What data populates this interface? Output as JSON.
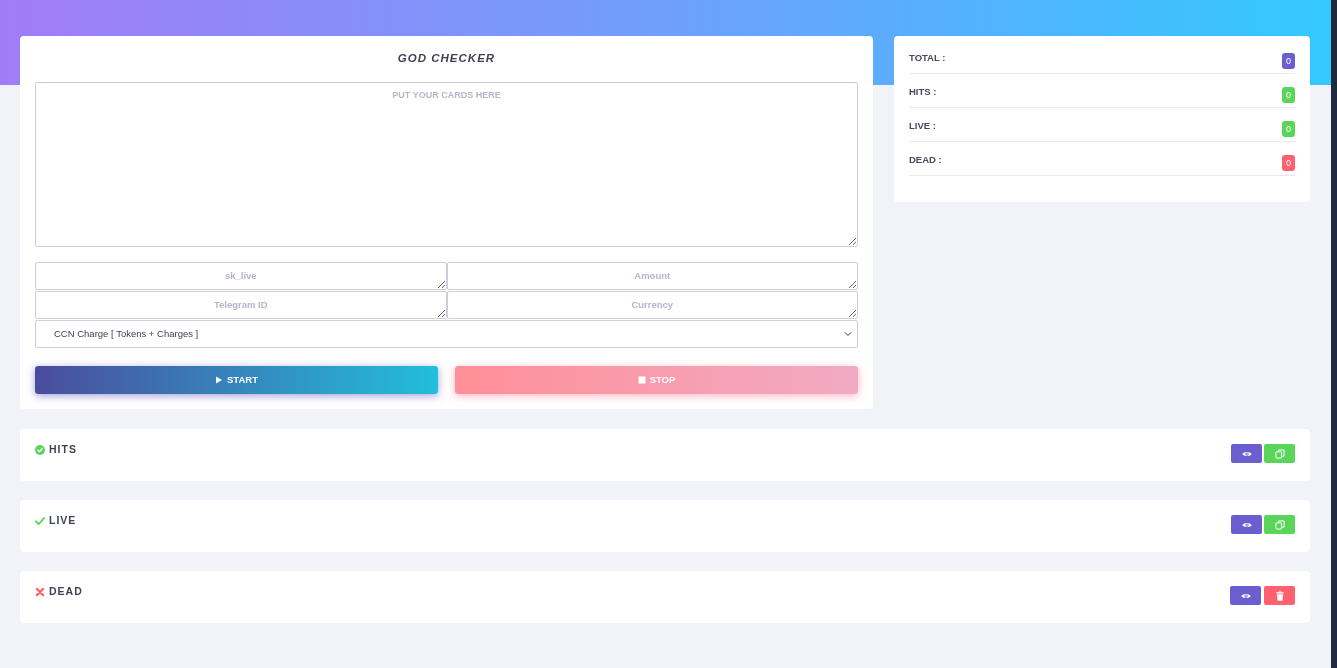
{
  "checker": {
    "title": "GOD CHECKER",
    "cards_field": {
      "placeholder": "PUT YOUR CARDS HERE"
    },
    "fields": [
      {
        "placeholder": "sk_live"
      },
      {
        "placeholder": "Amount"
      },
      {
        "placeholder": "Telegram ID"
      },
      {
        "placeholder": "Currency"
      }
    ],
    "gate_select": {
      "value": "CCN Charge [ Tokens + Charges ]"
    },
    "buttons": [
      {
        "kind": "start",
        "label": "START"
      },
      {
        "kind": "stop",
        "label": "STOP"
      }
    ]
  },
  "stats": [
    {
      "label": "TOTAL :",
      "count": "0",
      "color": "#6b5fcf"
    },
    {
      "label": "HITS :",
      "count": "0",
      "color": "#5ad55a"
    },
    {
      "label": "LIVE :",
      "count": "0",
      "color": "#5ad55a"
    },
    {
      "label": "DEAD :",
      "count": "0",
      "color": "#ff6070"
    }
  ],
  "result_panels": [
    {
      "kind": "hits",
      "title": "HITS",
      "buttons": [
        {
          "kind": "view"
        },
        {
          "kind": "copy"
        }
      ]
    },
    {
      "kind": "live",
      "title": "LIVE",
      "buttons": [
        {
          "kind": "view"
        },
        {
          "kind": "copy"
        }
      ]
    },
    {
      "kind": "dead",
      "title": "DEAD",
      "buttons": [
        {
          "kind": "view"
        },
        {
          "kind": "clear"
        }
      ]
    }
  ]
}
